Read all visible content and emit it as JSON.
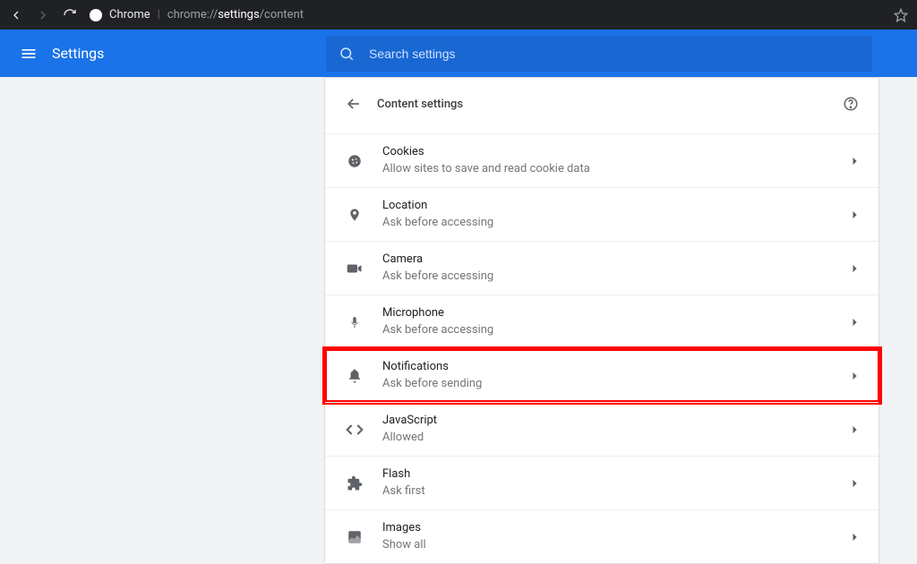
{
  "browser": {
    "chrome_label": "Chrome",
    "url_dim": "chrome://",
    "url_bright": "settings",
    "url_tail": "/content"
  },
  "header": {
    "title": "Settings",
    "search_placeholder": "Search settings"
  },
  "panel": {
    "title": "Content settings",
    "rows": [
      {
        "id": "cookies",
        "title": "Cookies",
        "sub": "Allow sites to save and read cookie data"
      },
      {
        "id": "location",
        "title": "Location",
        "sub": "Ask before accessing"
      },
      {
        "id": "camera",
        "title": "Camera",
        "sub": "Ask before accessing"
      },
      {
        "id": "microphone",
        "title": "Microphone",
        "sub": "Ask before accessing"
      },
      {
        "id": "notifications",
        "title": "Notifications",
        "sub": "Ask before sending",
        "highlight": true
      },
      {
        "id": "javascript",
        "title": "JavaScript",
        "sub": "Allowed"
      },
      {
        "id": "flash",
        "title": "Flash",
        "sub": "Ask first"
      },
      {
        "id": "images",
        "title": "Images",
        "sub": "Show all"
      }
    ]
  }
}
